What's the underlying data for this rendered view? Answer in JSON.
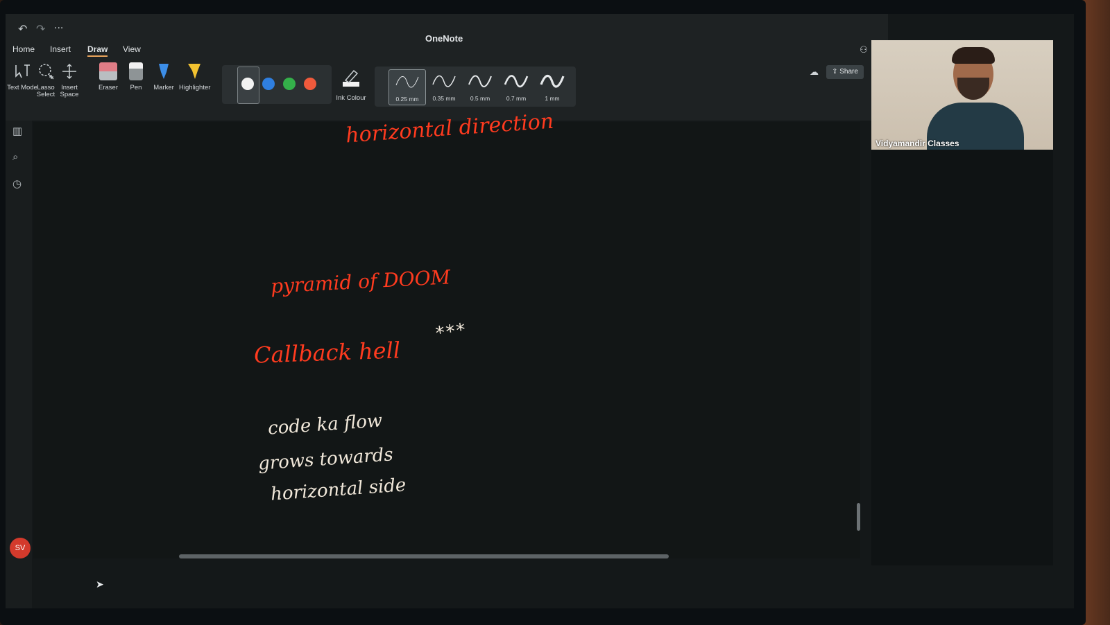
{
  "app": {
    "title": "OneNote"
  },
  "quick_access": {
    "undo": "↶",
    "redo": "↷",
    "more": "..."
  },
  "tabs": [
    {
      "label": "Home"
    },
    {
      "label": "Insert"
    },
    {
      "label": "Draw",
      "active": true
    },
    {
      "label": "View"
    }
  ],
  "ribbon": {
    "tools": [
      {
        "label": "Text Mode"
      },
      {
        "label": "Lasso Select"
      },
      {
        "label": "Insert Space"
      },
      {
        "label": "Eraser"
      },
      {
        "label": "Pen"
      },
      {
        "label": "Marker"
      },
      {
        "label": "Highlighter"
      }
    ],
    "pen_colors": [
      "#f2f2f2",
      "#2f7fe0",
      "#34b04a",
      "#f05a3c"
    ],
    "ink_colour_label": "Ink Colour",
    "thicknesses": [
      {
        "label": "0.25 mm",
        "selected": true
      },
      {
        "label": "0.35 mm"
      },
      {
        "label": "0.5 mm"
      },
      {
        "label": "0.7 mm"
      },
      {
        "label": "1 mm"
      }
    ],
    "share_label": "Share"
  },
  "user": {
    "initials": "SV"
  },
  "video": {
    "participant_name": "Vidyamandir Classes"
  },
  "notes": {
    "heading": "horizontal direction",
    "label_pyramid": "pyramid of DOOM",
    "checkmark": "✔",
    "circled": "Callback hell",
    "stars": "***",
    "arrow": "⇒",
    "body_lines": [
      "code ka flow",
      "grows towards",
      "horizontal side"
    ]
  },
  "colors": {
    "ink_red": "#ff3b1f",
    "ink_white": "#f1e8da",
    "ink_gray": "#d8d8d8",
    "accent_tab": "#e8a35b"
  }
}
